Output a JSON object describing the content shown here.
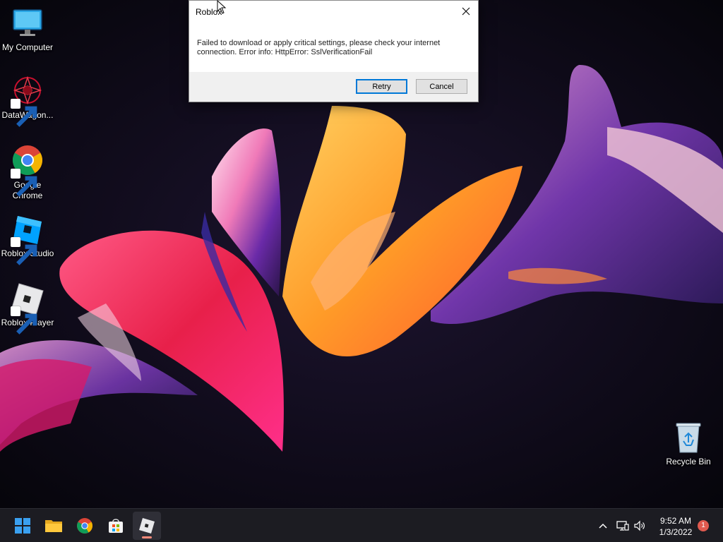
{
  "desktop": {
    "icons": [
      {
        "label": "My Computer",
        "icon": "monitor-icon"
      },
      {
        "label": "DataWagon...",
        "icon": "datawagon-icon"
      },
      {
        "label": "Google Chrome",
        "icon": "chrome-icon"
      },
      {
        "label": "Roblox Studio",
        "icon": "roblox-studio-icon"
      },
      {
        "label": "Roblox Player",
        "icon": "roblox-player-icon"
      },
      {
        "label": "Recycle Bin",
        "icon": "recycle-bin-icon"
      }
    ]
  },
  "dialog": {
    "title": "Roblox",
    "message": "Failed to download or apply critical settings, please check your internet connection. Error info: HttpError: SslVerificationFail",
    "retry_label": "Retry",
    "cancel_label": "Cancel"
  },
  "taskbar": {
    "apps": [
      "start-icon",
      "file-explorer-icon",
      "chrome-icon",
      "store-icon",
      "roblox-icon"
    ],
    "active_app": "roblox-icon",
    "tray": [
      "chevron-up-icon",
      "network-icon",
      "volume-icon"
    ],
    "time": "9:52 AM",
    "date": "1/3/2022",
    "notification_count": "1"
  },
  "colors": {
    "accent": "#0078d7",
    "taskbar": "#1c1c22",
    "notification": "#e05a4f"
  }
}
